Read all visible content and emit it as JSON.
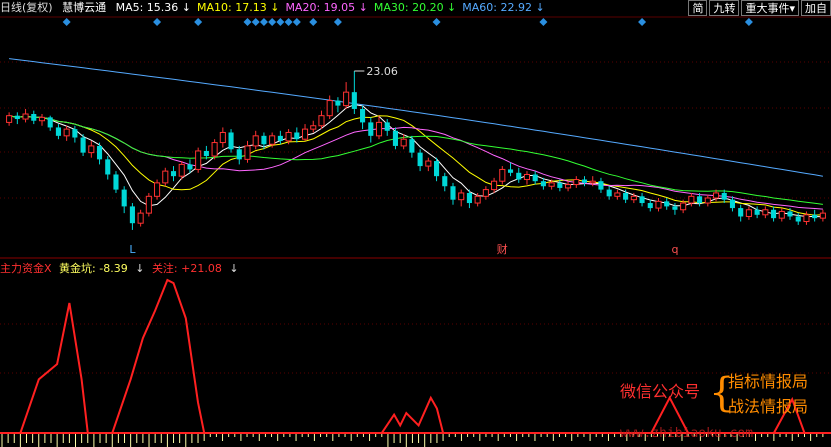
{
  "header": {
    "period": "日线(复权)",
    "stock_name": "慧博云通",
    "ma": [
      {
        "label": "MA5: 15.36",
        "color": "#ffffff"
      },
      {
        "label": "MA10: 17.13",
        "color": "#ffff00"
      },
      {
        "label": "MA20: 19.05",
        "color": "#ff66ff"
      },
      {
        "label": "MA30: 20.20",
        "color": "#33ff33"
      },
      {
        "label": "MA60: 22.92",
        "color": "#55aaff"
      }
    ],
    "arrow": "↓",
    "buttons": [
      "简",
      "九转",
      "重大事件",
      "加自"
    ],
    "dropdown": "▾"
  },
  "sub": {
    "indicator": "主力资金X",
    "line1": "黄金坑: -8.39",
    "line2": "关注: +21.08",
    "arrow": "↓"
  },
  "watermark": {
    "left": "微信公众号",
    "brace": "{",
    "right1": "指标情报局",
    "right2": "战法情报局",
    "site": "www.zhibiaoku.com"
  },
  "colors": {
    "up": "#ff3232",
    "down": "#00d8d8",
    "ma5": "#ffffff",
    "ma10": "#ffff00",
    "ma20": "#ff66ff",
    "ma30": "#33ff33",
    "ma60": "#55aaff",
    "diamond": "#2a8fe0",
    "osc": "#ff2020",
    "bars": "#ffffaa",
    "grid": "#5a0000"
  },
  "chart_data": {
    "type": "candlestick",
    "high_label": "23.06",
    "markers": [
      {
        "text": "L",
        "color": "#4ab0ff",
        "index": 15
      },
      {
        "text": "财",
        "color": "#ff5050",
        "index": 60
      },
      {
        "text": "q",
        "color": "#ff5050",
        "index": 81
      }
    ],
    "diamonds": [
      7,
      18,
      23,
      29,
      30,
      31,
      32,
      33,
      34,
      35,
      37,
      40,
      52,
      65,
      77,
      90
    ],
    "ylim": [
      13.0,
      25.5
    ],
    "candles": [
      [
        20.0,
        20.4,
        20.6,
        19.8
      ],
      [
        20.4,
        20.2,
        20.6,
        19.9
      ],
      [
        20.2,
        20.5,
        20.8,
        20.0
      ],
      [
        20.5,
        20.1,
        20.7,
        19.9
      ],
      [
        20.1,
        20.3,
        20.5,
        19.8
      ],
      [
        20.3,
        19.7,
        20.4,
        19.5
      ],
      [
        19.7,
        19.2,
        19.9,
        19.0
      ],
      [
        19.2,
        19.6,
        19.8,
        18.9
      ],
      [
        19.6,
        19.1,
        19.8,
        18.8
      ],
      [
        19.1,
        18.2,
        19.3,
        18.0
      ],
      [
        18.2,
        18.6,
        18.9,
        17.9
      ],
      [
        18.6,
        17.8,
        18.8,
        17.5
      ],
      [
        17.8,
        16.9,
        18.0,
        16.6
      ],
      [
        16.9,
        16.0,
        17.1,
        15.8
      ],
      [
        16.0,
        15.0,
        16.2,
        14.6
      ],
      [
        15.0,
        14.0,
        15.2,
        13.6
      ],
      [
        14.0,
        14.6,
        14.8,
        13.8
      ],
      [
        14.6,
        15.6,
        15.8,
        14.4
      ],
      [
        15.6,
        16.4,
        16.6,
        15.4
      ],
      [
        16.4,
        17.1,
        17.3,
        16.2
      ],
      [
        17.1,
        16.8,
        17.4,
        16.5
      ],
      [
        16.8,
        17.5,
        17.7,
        16.6
      ],
      [
        17.5,
        17.2,
        17.8,
        17.0
      ],
      [
        17.2,
        18.3,
        18.5,
        17.0
      ],
      [
        18.3,
        18.0,
        18.6,
        17.8
      ],
      [
        18.0,
        18.8,
        19.0,
        17.8
      ],
      [
        18.8,
        19.4,
        19.7,
        18.5
      ],
      [
        19.4,
        18.4,
        19.6,
        18.2
      ],
      [
        18.4,
        17.8,
        18.6,
        17.5
      ],
      [
        17.8,
        18.6,
        18.9,
        17.6
      ],
      [
        18.6,
        19.2,
        19.5,
        18.4
      ],
      [
        19.2,
        18.7,
        19.4,
        18.4
      ],
      [
        18.7,
        19.2,
        19.4,
        18.5
      ],
      [
        19.2,
        18.9,
        19.5,
        18.7
      ],
      [
        18.9,
        19.4,
        19.6,
        18.7
      ],
      [
        19.4,
        19.0,
        19.7,
        18.8
      ],
      [
        19.0,
        19.6,
        19.9,
        18.9
      ],
      [
        19.6,
        19.8,
        20.1,
        19.4
      ],
      [
        19.8,
        20.4,
        20.7,
        19.6
      ],
      [
        20.4,
        21.3,
        21.6,
        20.2
      ],
      [
        21.3,
        21.0,
        21.5,
        20.6
      ],
      [
        21.0,
        21.8,
        22.4,
        20.8
      ],
      [
        21.8,
        20.8,
        23.06,
        20.5
      ],
      [
        20.8,
        20.0,
        21.0,
        19.6
      ],
      [
        20.0,
        19.2,
        20.3,
        18.8
      ],
      [
        19.2,
        20.0,
        20.4,
        19.0
      ],
      [
        20.0,
        19.5,
        20.2,
        19.2
      ],
      [
        19.5,
        18.6,
        19.7,
        18.4
      ],
      [
        18.6,
        19.0,
        19.3,
        18.4
      ],
      [
        19.0,
        18.2,
        19.2,
        17.9
      ],
      [
        18.2,
        17.4,
        18.4,
        17.1
      ],
      [
        17.4,
        17.7,
        17.9,
        17.1
      ],
      [
        17.7,
        16.8,
        17.9,
        16.5
      ],
      [
        16.8,
        16.2,
        17.0,
        15.9
      ],
      [
        16.2,
        15.4,
        16.4,
        15.1
      ],
      [
        15.4,
        15.8,
        16.0,
        15.0
      ],
      [
        15.8,
        15.2,
        16.0,
        14.9
      ],
      [
        15.2,
        15.6,
        15.8,
        15.0
      ],
      [
        15.6,
        16.0,
        16.2,
        15.4
      ],
      [
        16.0,
        16.5,
        16.7,
        15.8
      ],
      [
        16.5,
        17.2,
        17.4,
        16.3
      ],
      [
        17.2,
        17.0,
        17.6,
        16.8
      ],
      [
        17.0,
        16.6,
        17.3,
        16.4
      ],
      [
        16.6,
        16.9,
        17.1,
        16.3
      ],
      [
        16.9,
        16.5,
        17.1,
        16.3
      ],
      [
        16.5,
        16.2,
        16.7,
        16.0
      ],
      [
        16.2,
        16.4,
        16.6,
        16.0
      ],
      [
        16.4,
        16.1,
        16.6,
        15.9
      ],
      [
        16.1,
        16.3,
        16.5,
        15.9
      ],
      [
        16.3,
        16.6,
        16.8,
        16.1
      ],
      [
        16.6,
        16.4,
        16.8,
        16.2
      ],
      [
        16.4,
        16.5,
        16.8,
        16.2
      ],
      [
        16.5,
        16.0,
        16.7,
        15.8
      ],
      [
        16.0,
        15.6,
        16.2,
        15.4
      ],
      [
        15.6,
        15.8,
        16.0,
        15.4
      ],
      [
        15.8,
        15.4,
        16.0,
        15.2
      ],
      [
        15.4,
        15.6,
        15.8,
        15.2
      ],
      [
        15.6,
        15.2,
        15.8,
        15.0
      ],
      [
        15.2,
        14.9,
        15.4,
        14.7
      ],
      [
        14.9,
        15.3,
        15.5,
        14.7
      ],
      [
        15.3,
        15.0,
        15.5,
        14.8
      ],
      [
        15.0,
        14.8,
        15.2,
        14.5
      ],
      [
        14.8,
        15.2,
        15.4,
        14.6
      ],
      [
        15.2,
        15.6,
        15.8,
        15.0
      ],
      [
        15.6,
        15.2,
        15.8,
        15.0
      ],
      [
        15.2,
        15.5,
        15.7,
        15.0
      ],
      [
        15.5,
        15.8,
        16.0,
        15.3
      ],
      [
        15.8,
        15.4,
        16.0,
        15.2
      ],
      [
        15.4,
        14.9,
        15.6,
        14.7
      ],
      [
        14.9,
        14.4,
        15.1,
        14.1
      ],
      [
        14.4,
        14.8,
        15.0,
        14.2
      ],
      [
        14.8,
        14.5,
        15.0,
        14.3
      ],
      [
        14.5,
        14.8,
        15.0,
        14.3
      ],
      [
        14.8,
        14.3,
        15.0,
        14.1
      ],
      [
        14.3,
        14.7,
        14.9,
        14.1
      ],
      [
        14.7,
        14.4,
        14.9,
        14.2
      ],
      [
        14.4,
        14.1,
        14.6,
        13.9
      ],
      [
        14.1,
        14.5,
        14.7,
        13.9
      ],
      [
        14.5,
        14.3,
        14.8,
        14.1
      ],
      [
        14.3,
        14.6,
        14.8,
        14.1
      ]
    ],
    "ma60_start": 23.8,
    "ma60_end": 16.8,
    "osc_points": [
      [
        0,
        0
      ],
      [
        3,
        0
      ],
      [
        6,
        0.35
      ],
      [
        9,
        0.45
      ],
      [
        11,
        0.85
      ],
      [
        13,
        0.35
      ],
      [
        14,
        0
      ],
      [
        18,
        0
      ],
      [
        21,
        0.35
      ],
      [
        23,
        0.62
      ],
      [
        25,
        0.8
      ],
      [
        27,
        1.0
      ],
      [
        28,
        0.98
      ],
      [
        30,
        0.75
      ],
      [
        32,
        0.2
      ],
      [
        33,
        0
      ],
      [
        62,
        0
      ],
      [
        64,
        0.12
      ],
      [
        65,
        0.05
      ],
      [
        66,
        0.13
      ],
      [
        68,
        0.05
      ],
      [
        70,
        0.23
      ],
      [
        71,
        0.16
      ],
      [
        72,
        0
      ],
      [
        106,
        0
      ],
      [
        109,
        0.23
      ],
      [
        112,
        0
      ],
      [
        126,
        0
      ],
      [
        129,
        0.22
      ],
      [
        131,
        0
      ]
    ],
    "osc_total": 135
  }
}
